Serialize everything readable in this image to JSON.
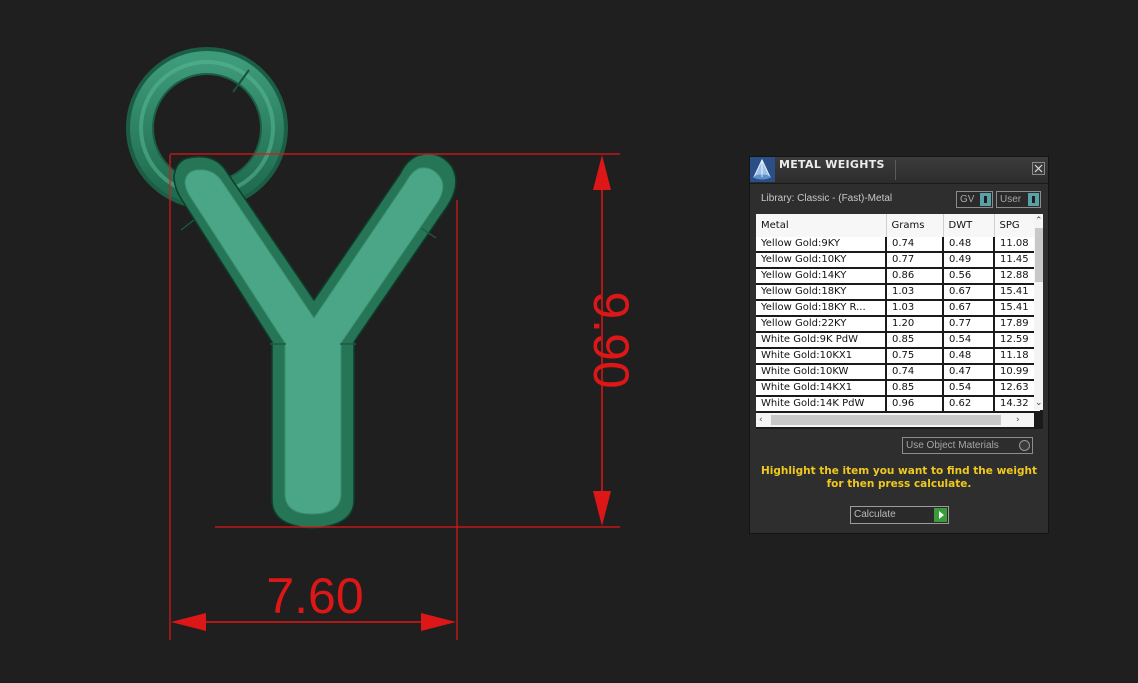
{
  "model": {
    "dimensions": {
      "height_label": "9.90",
      "width_label": "7.60"
    },
    "colors": {
      "metal": "#46a583",
      "dimension": "#dd1717",
      "background": "#201f1f"
    }
  },
  "panel": {
    "title": "METAL WEIGHTS",
    "library_label": "Library: Classic - (Fast)-Metal",
    "gv_dropdown": "GV",
    "user_dropdown": "User",
    "table": {
      "headers": [
        "Metal",
        "Grams",
        "DWT",
        "SPG"
      ],
      "rows": [
        [
          "Yellow Gold:9KY",
          "0.74",
          "0.48",
          "11.08"
        ],
        [
          "Yellow Gold:10KY",
          "0.77",
          "0.49",
          "11.45"
        ],
        [
          "Yellow Gold:14KY",
          "0.86",
          "0.56",
          "12.88"
        ],
        [
          "Yellow Gold:18KY",
          "1.03",
          "0.67",
          "15.41"
        ],
        [
          "Yellow Gold:18KY R...",
          "1.03",
          "0.67",
          "15.41"
        ],
        [
          "Yellow Gold:22KY",
          "1.20",
          "0.77",
          "17.89"
        ],
        [
          "White Gold:9K PdW",
          "0.85",
          "0.54",
          "12.59"
        ],
        [
          "White Gold:10KX1",
          "0.75",
          "0.48",
          "11.18"
        ],
        [
          "White Gold:10KW",
          "0.74",
          "0.47",
          "10.99"
        ],
        [
          "White Gold:14KX1",
          "0.85",
          "0.54",
          "12.63"
        ],
        [
          "White Gold:14K PdW",
          "0.96",
          "0.62",
          "14.32"
        ]
      ]
    },
    "use_object_materials": "Use Object Materials",
    "hint_line1": "Highlight the item you want to find the weight",
    "hint_line2": "for then press calculate.",
    "calculate_button": "Calculate",
    "close_icon": "close-icon",
    "app_icon": "metal-weights-icon",
    "hint_color": "#f0c91f"
  }
}
